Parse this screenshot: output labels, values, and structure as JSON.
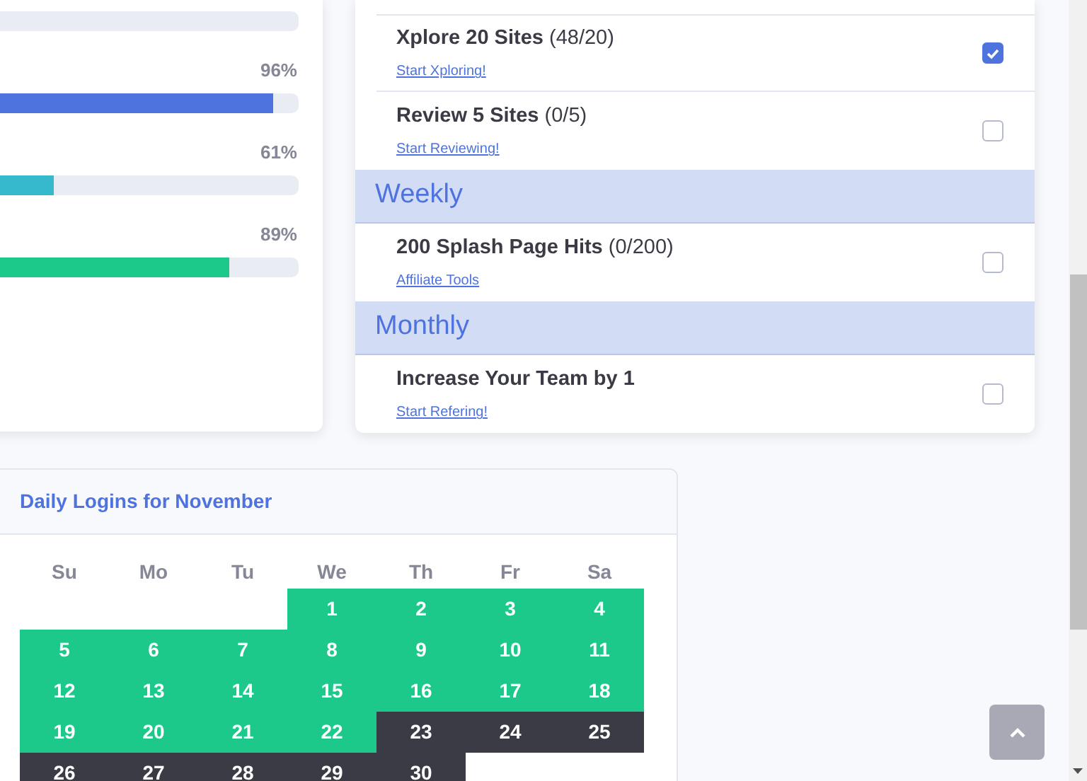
{
  "progress": [
    {
      "kind": "track"
    },
    {
      "kind": "bar",
      "reading": "96%",
      "level": 0.96,
      "color": "#4e73df"
    },
    {
      "kind": "bar",
      "reading": "61%",
      "level": 0.61,
      "color": "#36b9cc"
    },
    {
      "kind": "bar",
      "reading": "89%",
      "level": 0.89,
      "color": "#1cc88a"
    }
  ],
  "tasks": [
    {
      "kind": "item",
      "title": "Xplore 20 Sites",
      "count": "(48/20)",
      "link": "Start Xploring!",
      "checked": true
    },
    {
      "kind": "item",
      "title": "Review 5 Sites",
      "count": "(0/5)",
      "link": "Start Reviewing!",
      "checked": false
    },
    {
      "kind": "header",
      "title": "Weekly"
    },
    {
      "kind": "item",
      "title": "200 Splash Page Hits",
      "count": "(0/200)",
      "link": "Affiliate Tools",
      "checked": false
    },
    {
      "kind": "header",
      "title": "Monthly"
    },
    {
      "kind": "item",
      "title": "Increase Your Team by 1",
      "link": "Start Refering!",
      "checked": false
    }
  ],
  "calendar": {
    "title": "Daily Logins for November",
    "weekdays": [
      "Su",
      "Mo",
      "Tu",
      "We",
      "Th",
      "Fr",
      "Sa"
    ],
    "weeks": [
      [
        {
          "day": "1",
          "logged": true
        },
        {
          "day": "2",
          "logged": true
        },
        {
          "day": "3",
          "logged": true
        },
        {
          "day": "4",
          "logged": true
        }
      ],
      [
        {
          "day": "5",
          "logged": true
        },
        {
          "day": "6",
          "logged": true
        },
        {
          "day": "7",
          "logged": true
        },
        {
          "day": "8",
          "logged": true
        },
        {
          "day": "9",
          "logged": true
        },
        {
          "day": "10",
          "logged": true
        },
        {
          "day": "11",
          "logged": true
        }
      ],
      [
        {
          "day": "12",
          "logged": true
        },
        {
          "day": "13",
          "logged": true
        },
        {
          "day": "14",
          "logged": true
        },
        {
          "day": "15",
          "logged": true
        },
        {
          "day": "16",
          "logged": true
        },
        {
          "day": "17",
          "logged": true
        },
        {
          "day": "18",
          "logged": true
        }
      ],
      [
        {
          "day": "19",
          "logged": true
        },
        {
          "day": "20",
          "logged": true
        },
        {
          "day": "21",
          "logged": true
        },
        {
          "day": "22",
          "logged": true
        },
        {
          "day": "23",
          "logged": false
        },
        {
          "day": "24",
          "logged": false
        },
        {
          "day": "25",
          "logged": false
        }
      ],
      [
        {
          "day": "26",
          "logged": false
        },
        {
          "day": "27",
          "logged": false
        },
        {
          "day": "28",
          "logged": false
        },
        {
          "day": "29",
          "logged": false
        },
        {
          "day": "30",
          "logged": false
        }
      ]
    ]
  }
}
